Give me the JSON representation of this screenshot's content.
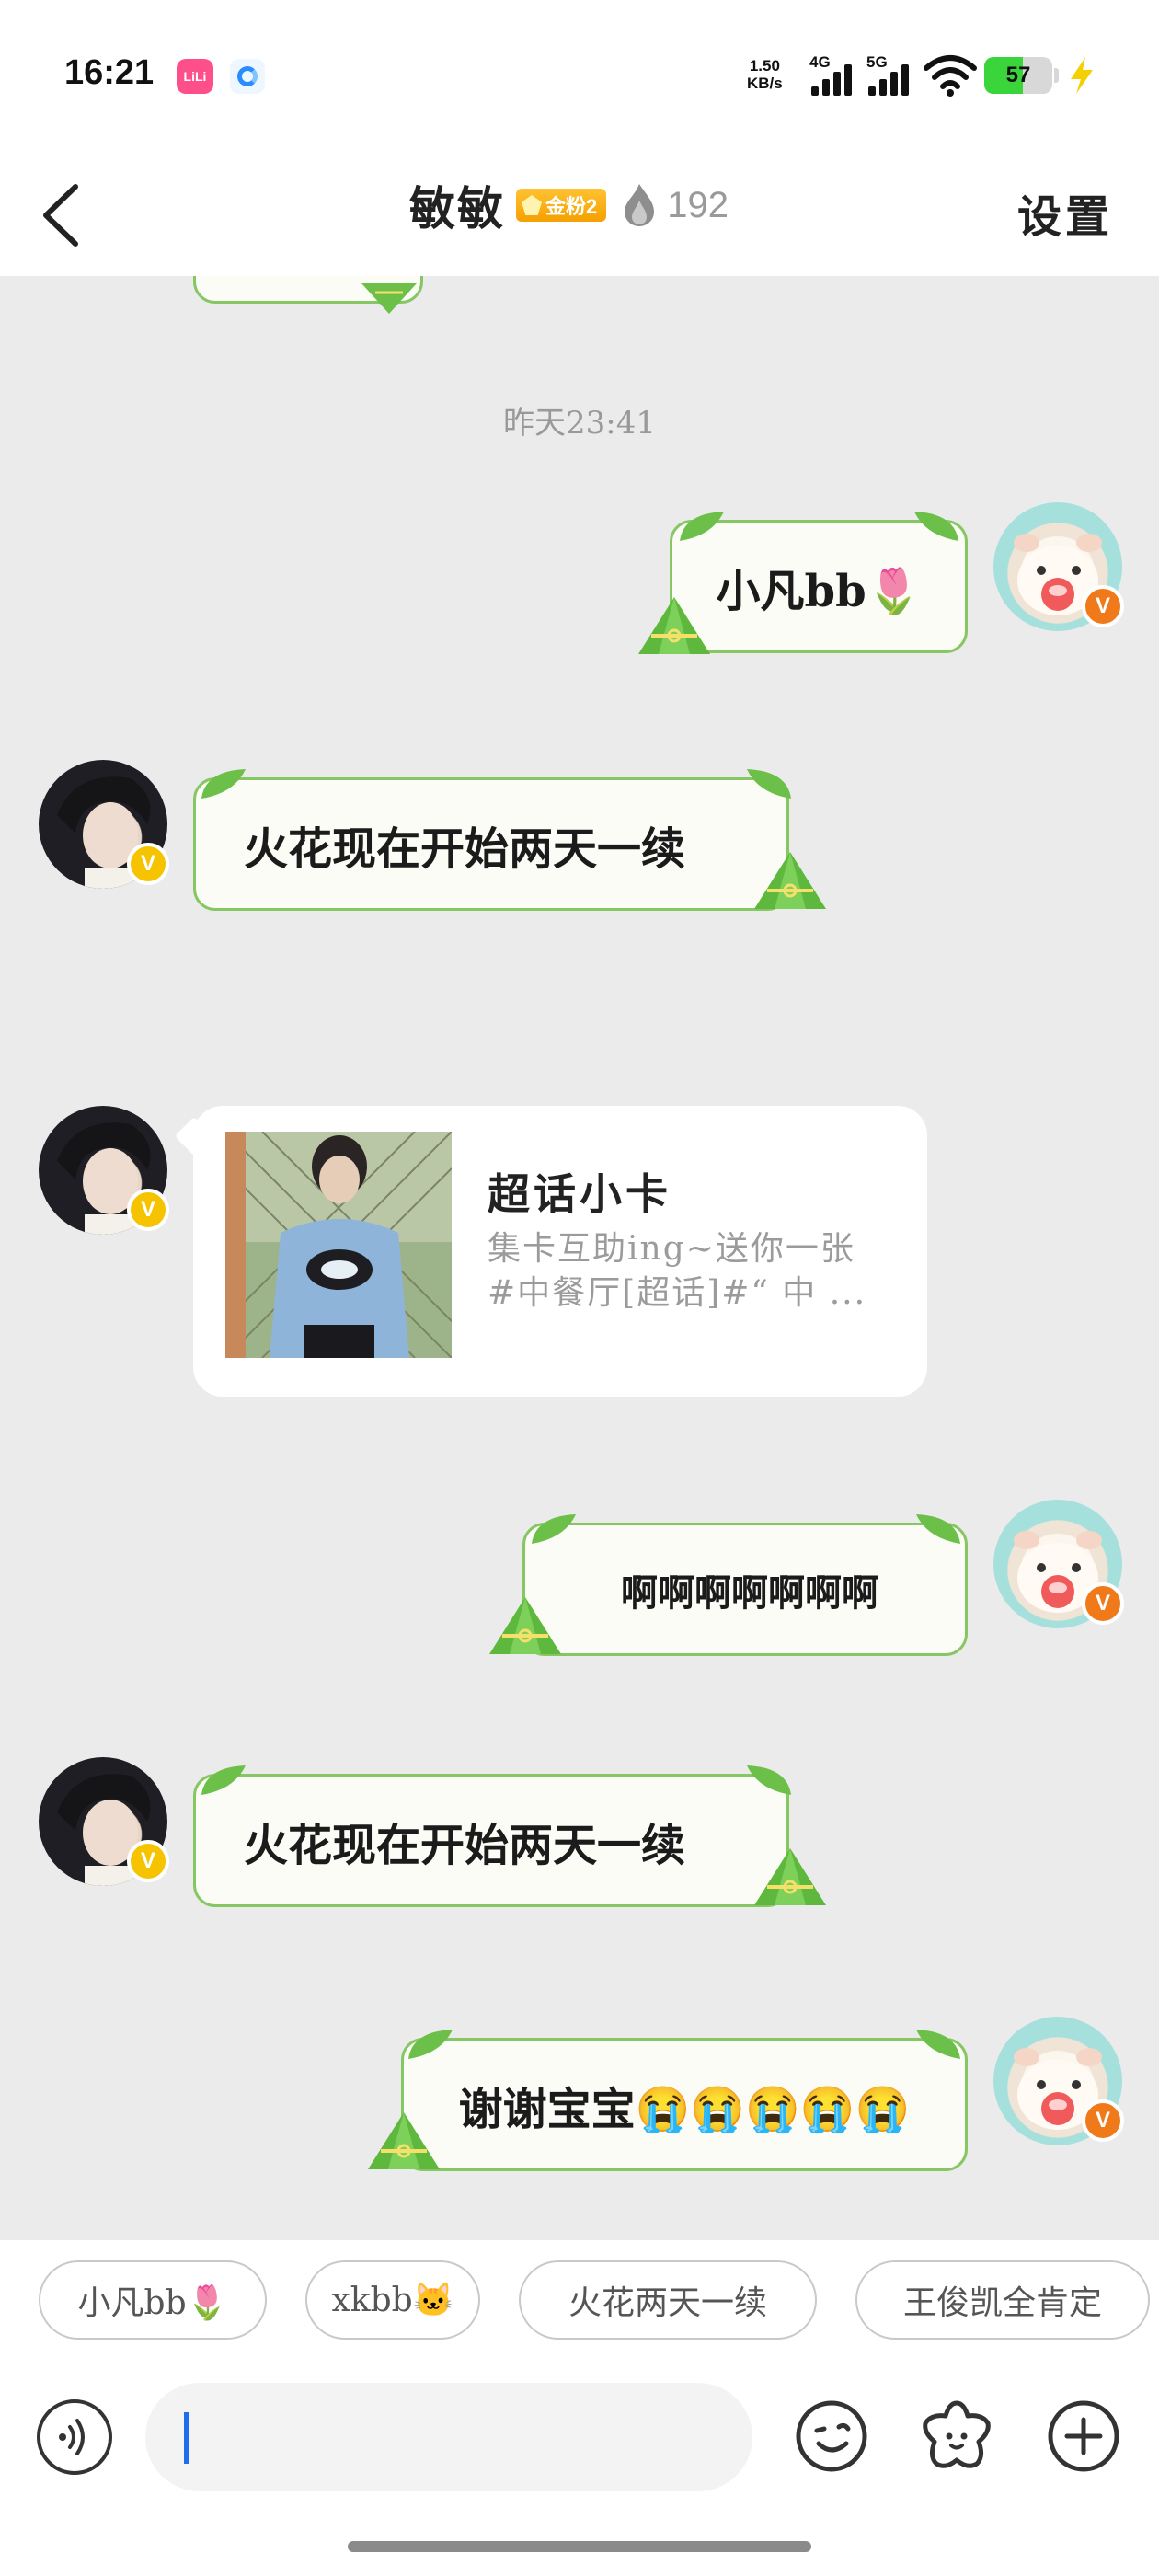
{
  "status_bar": {
    "time": "16:21",
    "app_icon_label": "LiLi",
    "net_speed_value": "1.50",
    "net_speed_unit": "KB/s",
    "signal_1": "4G",
    "signal_2": "5G",
    "battery": "57",
    "battery_level": 0.57,
    "icons": [
      "app-notification-icon",
      "browser-icon",
      "wifi-icon",
      "charging-icon"
    ]
  },
  "header": {
    "title": "敏敏",
    "fan_badge": "金粉2",
    "fire_count": "192",
    "settings_label": "设置",
    "icons": [
      "back-arrow-icon",
      "flame-icon"
    ]
  },
  "chat": {
    "timestamp": "昨天23:41",
    "messages": [
      {
        "side": "right",
        "type": "text",
        "text": "小凡bb🌷"
      },
      {
        "side": "left",
        "type": "text",
        "text": "火花现在开始两天一续"
      },
      {
        "side": "left",
        "type": "card",
        "title": "超话小卡",
        "desc_line1": "集卡互助ing~送你一张",
        "desc_line2": "#中餐厅[超话]#“ 中 ..."
      },
      {
        "side": "right",
        "type": "text",
        "text": "啊啊啊啊啊啊啊"
      },
      {
        "side": "left",
        "type": "text",
        "text": "火花现在开始两天一续"
      },
      {
        "side": "right",
        "type": "text",
        "text": "谢谢宝宝😭😭😭😭😭"
      }
    ],
    "verified_mark": "V"
  },
  "quick_replies": [
    "小凡bb🌷",
    "xkbb🐱",
    "火花两天一续",
    "王俊凯全肯定"
  ],
  "input": {
    "value": "",
    "icons": [
      "voice-icon",
      "emoji-icon",
      "sticker-icon",
      "plus-icon"
    ]
  },
  "colors": {
    "bubble_border": "#86c764",
    "bubble_bg": "#fbfcf6",
    "chat_bg": "#ebebeb",
    "caret": "#1e6cf0",
    "badge_gold": "#f5a000",
    "battery_green": "#3ad53a"
  }
}
